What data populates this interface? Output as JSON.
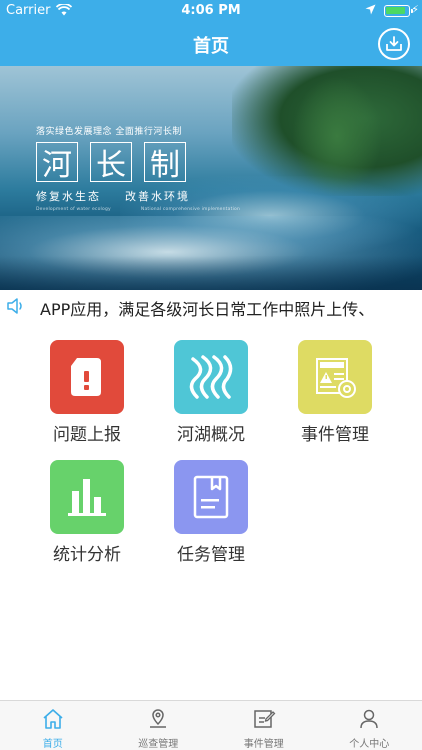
{
  "status_bar": {
    "carrier": "Carrier",
    "time": "4:06 PM"
  },
  "nav": {
    "title": "首页",
    "download_icon": "download-icon"
  },
  "banner": {
    "slogan": "落实绿色发展理念 全面推行河长制",
    "big_chars": [
      "河",
      "长",
      "制"
    ],
    "sub_left": "修复水生态",
    "sub_right": "改善水环境",
    "tiny_left": "Development of water ecology",
    "tiny_right": "National comprehensive implementation"
  },
  "notice": {
    "text": "APP应用，满足各级河长日常工作中照片上传、"
  },
  "grid": [
    {
      "label": "问题上报",
      "color": "#e14a3b",
      "icon": "report-icon"
    },
    {
      "label": "河湖概况",
      "color": "#4fc6d6",
      "icon": "river-icon"
    },
    {
      "label": "事件管理",
      "color": "#dedb63",
      "icon": "event-icon"
    },
    {
      "label": "统计分析",
      "color": "#67d26b",
      "icon": "chart-icon"
    },
    {
      "label": "任务管理",
      "color": "#8b96f0",
      "icon": "task-icon"
    }
  ],
  "tabs": [
    {
      "label": "首页",
      "icon": "home-icon",
      "active": true
    },
    {
      "label": "巡查管理",
      "icon": "patrol-icon",
      "active": false
    },
    {
      "label": "事件管理",
      "icon": "edit-icon",
      "active": false
    },
    {
      "label": "个人中心",
      "icon": "person-icon",
      "active": false
    }
  ],
  "colors": {
    "primary": "#3daee9",
    "tab_active": "#3daee9",
    "tab_inactive": "#777777"
  }
}
